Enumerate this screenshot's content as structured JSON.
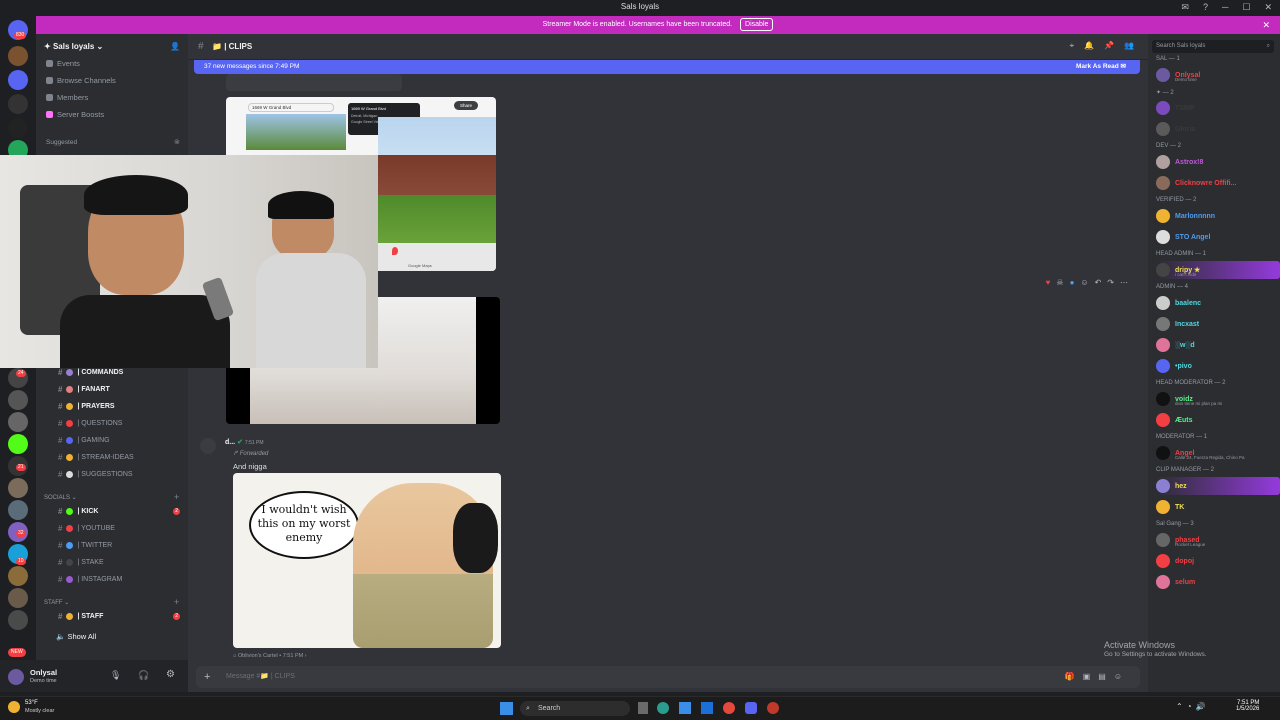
{
  "window": {
    "title": "Sals loyals"
  },
  "banner": {
    "text": "Streamer Mode is enabled. Usernames have been truncated.",
    "button": "Disable"
  },
  "rail": {
    "top_badge": "830",
    "badges": [
      "24",
      "27",
      "21",
      "32",
      "10"
    ],
    "new_label": "NEW"
  },
  "sidebar": {
    "server_name": "Sals loyals",
    "nav": [
      "Events",
      "Browse Channels",
      "Members",
      "Server Boosts"
    ],
    "suggested": "Suggested",
    "channels_main": [
      "| COMMANDS",
      "| FANART",
      "| PRAYERS",
      "| QUESTIONS",
      "| GAMING",
      "| STREAM-IDEAS",
      "| SUGGESTIONS"
    ],
    "cat_socials": "SOCIALS",
    "channels_socials": [
      "| KICK",
      "| YOUTUBE",
      "| TWITTER",
      "| STAKE",
      "| INSTAGRAM"
    ],
    "kick_badge": "2",
    "cat_staff": "STAFF",
    "channels_staff": [
      "| STAFF"
    ],
    "staff_badge": "2",
    "show_all": "Show All"
  },
  "user": {
    "name": "Onlysal",
    "status": "Demo time"
  },
  "header": {
    "channel": "| CLIPS"
  },
  "new_messages": {
    "text": "37 new messages since 7:49 PM",
    "mark": "Mark As Read"
  },
  "map_attachment": {
    "address": "1669 W Grand Blvd",
    "share": "Share",
    "panel_title": "1669 W Grand Blvd",
    "panel_sub": "Detroit, Michigan",
    "panel_link": "Google Street View",
    "footer": "Google Maps"
  },
  "message": {
    "author": "d...",
    "time": "7:51 PM",
    "forwarded": "Forwarded",
    "text": "And nigga",
    "meme_text": "I wouldn't wish this on my worst enemy",
    "origin": "Oblivion's Cartel",
    "origin_time": "7:51 PM"
  },
  "composer": {
    "placeholder": "Message #📁 | CLIPS"
  },
  "members": {
    "search": "Search Sals loyals",
    "groups": [
      {
        "header": "SAL — 1",
        "items": [
          {
            "name": "Onlysal",
            "sub": "Demo time",
            "color": "#f23f43",
            "av": "#6b5aa0"
          }
        ]
      },
      {
        "header": "✦ — 2",
        "items": [
          {
            "name": "TSMP",
            "sub": "",
            "color": "#3a3a3a",
            "av": "#7b4bbd"
          },
          {
            "name": "Gloria",
            "sub": "",
            "color": "#3a3a3a",
            "av": "#5a5a5a"
          }
        ]
      },
      {
        "header": "DEV — 2",
        "items": [
          {
            "name": "Astrox!8",
            "sub": "",
            "color": "#c05ad8",
            "av": "#b0a0a0"
          },
          {
            "name": "Clicknowre Offifi...",
            "sub": "",
            "color": "#f23f43",
            "av": "#8a6b5b"
          }
        ]
      },
      {
        "header": "VERIFIED — 2",
        "items": [
          {
            "name": "Marlonnnnn",
            "sub": "",
            "color": "#4f9cf0",
            "av": "#f0b232"
          },
          {
            "name": "STO Angel",
            "sub": "",
            "color": "#4f9cf0",
            "av": "#dddddd"
          }
        ]
      },
      {
        "header": "HEAD ADMIN — 1",
        "items": [
          {
            "name": "dripy ★",
            "sub": "i can't hide",
            "color": "#f0e050",
            "av": "#444444"
          }
        ]
      },
      {
        "header": "ADMIN — 4",
        "items": [
          {
            "name": "baalenc",
            "sub": "",
            "color": "#4fd8e0",
            "av": "#cccccc"
          },
          {
            "name": "Incxast",
            "sub": "",
            "color": "#4fd8e0",
            "av": "#777777"
          },
          {
            "name": "░w░d",
            "sub": "",
            "color": "#4fd8e0",
            "av": "#e0739a"
          },
          {
            "name": "•pivo",
            "sub": "",
            "color": "#4fd8e0",
            "av": "#5865f2"
          }
        ]
      },
      {
        "header": "HEAD MODERATOR — 2",
        "items": [
          {
            "name": "voidz",
            "sub": "dios tiene mi plan pa mi",
            "color": "#57f287",
            "av": "#111111"
          },
          {
            "name": "Æuts",
            "sub": "",
            "color": "#57f287",
            "av": "#f23f43"
          }
        ]
      },
      {
        "header": "MODERATOR — 1",
        "items": [
          {
            "name": "Angel",
            "sub": "Calle 24, Fuerza Regida, Chino Pa",
            "color": "#f23f43",
            "av": "#111111"
          }
        ]
      },
      {
        "header": "CLIP MANAGER — 2",
        "items": [
          {
            "name": "hez",
            "sub": "",
            "color": "#f0e050",
            "av": "#8a7fd0"
          },
          {
            "name": "TK",
            "sub": "",
            "color": "#f0e050",
            "av": "#f0b232"
          }
        ]
      },
      {
        "header": "Sal Gang — 3",
        "items": [
          {
            "name": "phased",
            "sub": "Rocket League",
            "color": "#f23f43",
            "av": "#666666"
          },
          {
            "name": "dopoj",
            "sub": "",
            "color": "#f23f43",
            "av": "#f23f43"
          },
          {
            "name": "selum",
            "sub": "",
            "color": "#f23f43",
            "av": "#e0739a"
          }
        ]
      }
    ]
  },
  "activation": {
    "title": "Activate Windows",
    "sub": "Go to Settings to activate Windows."
  },
  "taskbar": {
    "weather_temp": "53°F",
    "weather_desc": "Mostly clear",
    "search": "Search",
    "time": "7:51 PM",
    "date": "1/5/2026"
  },
  "colors": {
    "blurple": "#5865f2",
    "streamer": "#c22bbe",
    "bg": "#313338"
  }
}
